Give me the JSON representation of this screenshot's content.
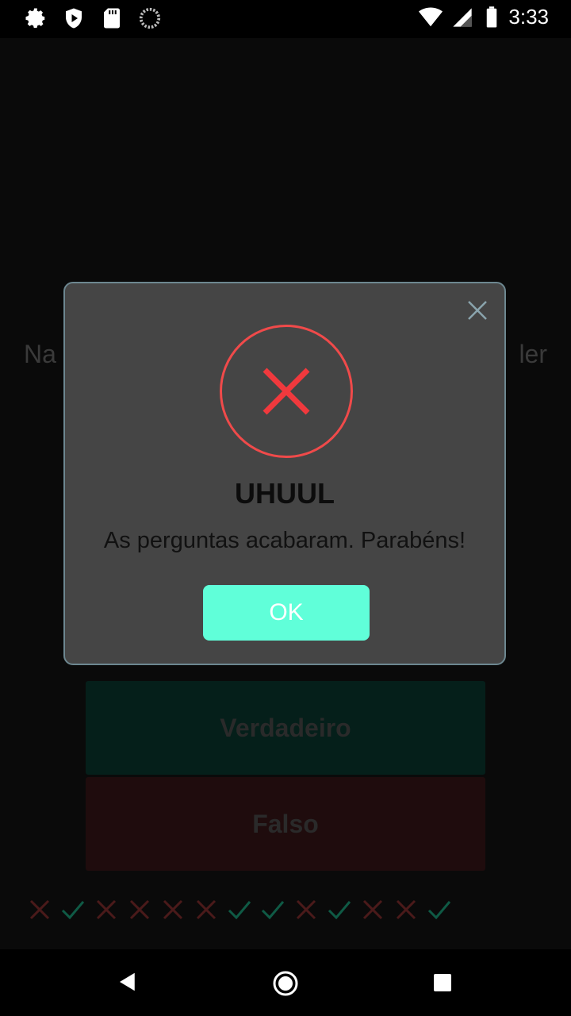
{
  "status_bar": {
    "time": "3:33",
    "icons_left": [
      "gear-icon",
      "play-shield-icon",
      "sd-card-icon",
      "loading-icon"
    ],
    "icons_right": [
      "wifi-icon",
      "signal-icon",
      "battery-icon"
    ]
  },
  "background": {
    "question_left_fragment": "Na",
    "question_right_fragment": "ler",
    "true_button_label": "Verdadeiro",
    "false_button_label": "Falso",
    "score_marks": [
      "wrong",
      "right",
      "wrong",
      "wrong",
      "wrong",
      "wrong",
      "right",
      "right",
      "wrong",
      "right",
      "wrong",
      "wrong",
      "right"
    ]
  },
  "dialog": {
    "title": "UHUUL",
    "message": "As perguntas acabaram. Parabéns!",
    "ok_label": "OK"
  },
  "colors": {
    "accent": "#60ffd9",
    "error": "#f04a4a",
    "dialog_bg": "#454545",
    "right_mark": "#0f5a45",
    "wrong_mark": "#4a1a1a"
  }
}
